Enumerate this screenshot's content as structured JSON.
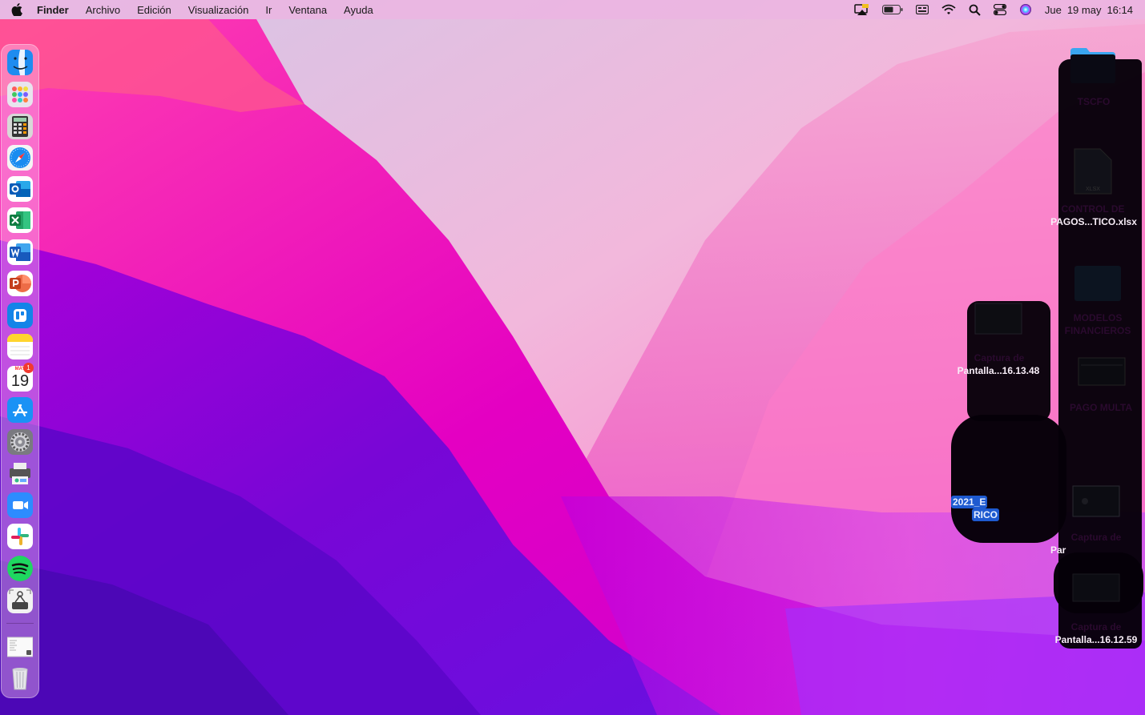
{
  "menubar": {
    "app_name": "Finder",
    "menus": [
      "Archivo",
      "Edición",
      "Visualización",
      "Ir",
      "Ventana",
      "Ayuda"
    ],
    "status_icons": [
      "display-mirroring-icon",
      "battery-icon",
      "input-menu-icon",
      "wifi-icon",
      "spotlight-search-icon",
      "control-center-icon",
      "siri-icon"
    ],
    "clock": {
      "day": "Jue",
      "date": "19 may",
      "time": "16:14"
    }
  },
  "dock": {
    "apps": [
      "Finder",
      "Launchpad",
      "Calculadora",
      "Safari",
      "Microsoft Outlook",
      "Microsoft Excel",
      "Microsoft Word",
      "Microsoft PowerPoint",
      "Microsoft To Do",
      "Notas",
      "Calendario",
      "App Store",
      "Preferencias del Sistema",
      "Impresora",
      "Zoom",
      "Slack",
      "Spotify",
      "Captura de pantalla",
      "Documento reciente",
      "Papelera"
    ],
    "calendar": {
      "month": "MAY",
      "day": "19",
      "badge": "1"
    }
  },
  "desktop": {
    "icons": [
      {
        "label_lines": [
          "TSCFO"
        ]
      },
      {
        "label_lines": [
          "CONTROL DE",
          "PAGOS...TICO.xlsx"
        ],
        "file_tag": "XLSX"
      },
      {
        "label_lines": [
          "MODELOS",
          "FINANCIEROS"
        ]
      },
      {
        "label_lines": [
          "Captura de",
          "Pantalla...16.13.48"
        ]
      },
      {
        "label_lines": [
          "PAGO MULTA"
        ]
      },
      {
        "label_lines": [
          "2021_E",
          "RICO"
        ]
      },
      {
        "label_lines": [
          "Captura de",
          "Par"
        ]
      },
      {
        "label_lines": [
          "Captura de",
          "Pantalla...16.12.59"
        ]
      }
    ]
  },
  "colors": {
    "menubar_bg": "#ecb4e2",
    "wallpaper_magenta": "#e000c0",
    "wallpaper_purple": "#6a00d8",
    "selection": "#1e5ad0"
  }
}
